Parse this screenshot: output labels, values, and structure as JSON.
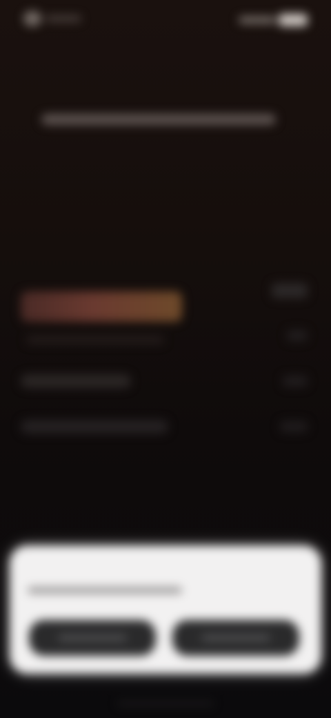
{
  "app": {
    "title": ""
  },
  "status_bar": {
    "time": "",
    "icons": [
      "signal-icon",
      "wifi-icon",
      "battery-icon"
    ]
  },
  "hero": {
    "title": ""
  },
  "list": {
    "items": [
      {
        "label": "",
        "subtitle": "",
        "value": ""
      },
      {
        "label": "",
        "value": ""
      },
      {
        "label": "",
        "value": ""
      }
    ],
    "header_value": ""
  },
  "dialog": {
    "message": "",
    "primary_button": "",
    "secondary_button": ""
  },
  "colors": {
    "background_top": "#1a110e",
    "background_bottom": "#0b0a0c",
    "highlight_row": "#6a3a30",
    "dialog_bg": "#f2f1f1",
    "dialog_button_bg": "#2a2a2b"
  }
}
